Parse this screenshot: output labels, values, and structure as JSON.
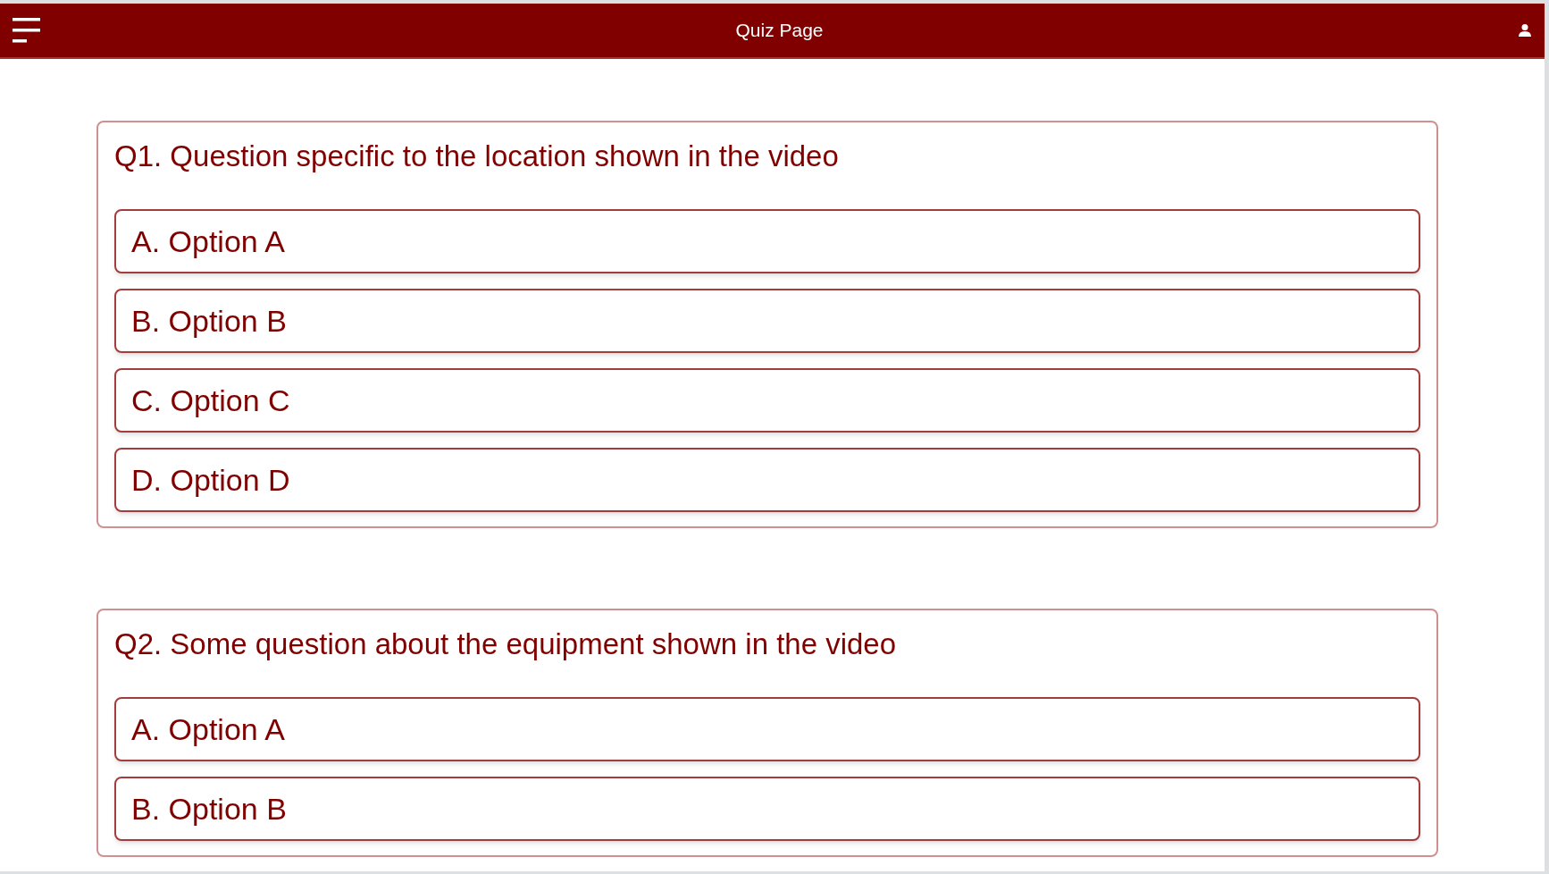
{
  "header": {
    "title": "Quiz Page"
  },
  "questions": [
    {
      "text": "Q1. Question specific to the location shown in the video",
      "options": [
        "A. Option A",
        "B. Option B",
        "C. Option C",
        "D. Option D"
      ]
    },
    {
      "text": "Q2. Some question about the equipment shown in the video",
      "options": [
        "A. Option A",
        "B. Option B"
      ]
    }
  ]
}
